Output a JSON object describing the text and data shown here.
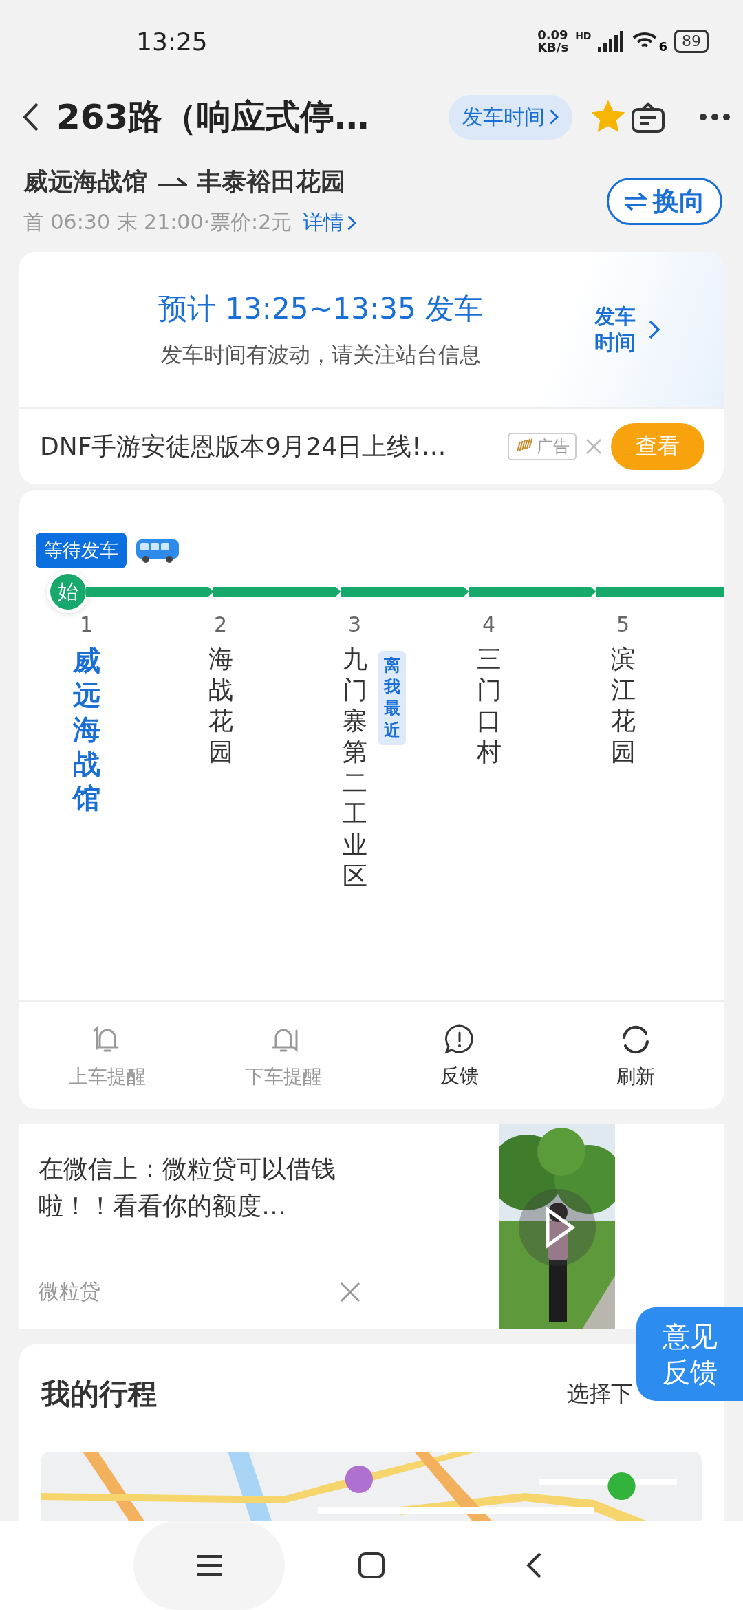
{
  "status_bar": {
    "time": "13:25",
    "speed_value": "0.09",
    "speed_unit": "KB/s",
    "network": "HD",
    "wifi_label": "6",
    "battery": "89"
  },
  "header": {
    "title": "263路（响应式停…",
    "departure_button": "发车时间",
    "starred": true
  },
  "route": {
    "from": "威远海战馆",
    "to": "丰泰裕田花园",
    "info": "首 06:30 末 21:00·票价:2元",
    "details_link": "详情",
    "reverse_button": "换向"
  },
  "departure": {
    "estimate": "预计 13:25~13:35 发车",
    "note": "发车时间有波动，请关注站台信息",
    "link": "发车时间"
  },
  "ad_banner": {
    "text": "DNF手游安徒恩版本9月24日上线!…",
    "tag": "广告",
    "button": "查看"
  },
  "bus_status": "等待发车",
  "start_badge": "始",
  "stops": [
    {
      "number": "1",
      "name": "威远海战馆",
      "selected": true
    },
    {
      "number": "2",
      "name": "海战花园",
      "selected": false
    },
    {
      "number": "3",
      "name": "九门寨第二工业区",
      "selected": false,
      "tag": "离我最近"
    },
    {
      "number": "4",
      "name": "三门口村",
      "selected": false
    },
    {
      "number": "5",
      "name": "滨江花园",
      "selected": false
    }
  ],
  "actions": [
    {
      "label": "上车提醒",
      "kind": "board",
      "disabled": true
    },
    {
      "label": "下车提醒",
      "kind": "alight",
      "disabled": true
    },
    {
      "label": "反馈",
      "kind": "feedback",
      "disabled": false
    },
    {
      "label": "刷新",
      "kind": "refresh",
      "disabled": false
    }
  ],
  "ad_card": {
    "text": "在微信上：微粒贷可以借钱啦！！看看你的额度…",
    "source": "微粒贷"
  },
  "trip": {
    "title": "我的行程",
    "link": "选择下"
  },
  "feedback_button": "意见反馈"
}
